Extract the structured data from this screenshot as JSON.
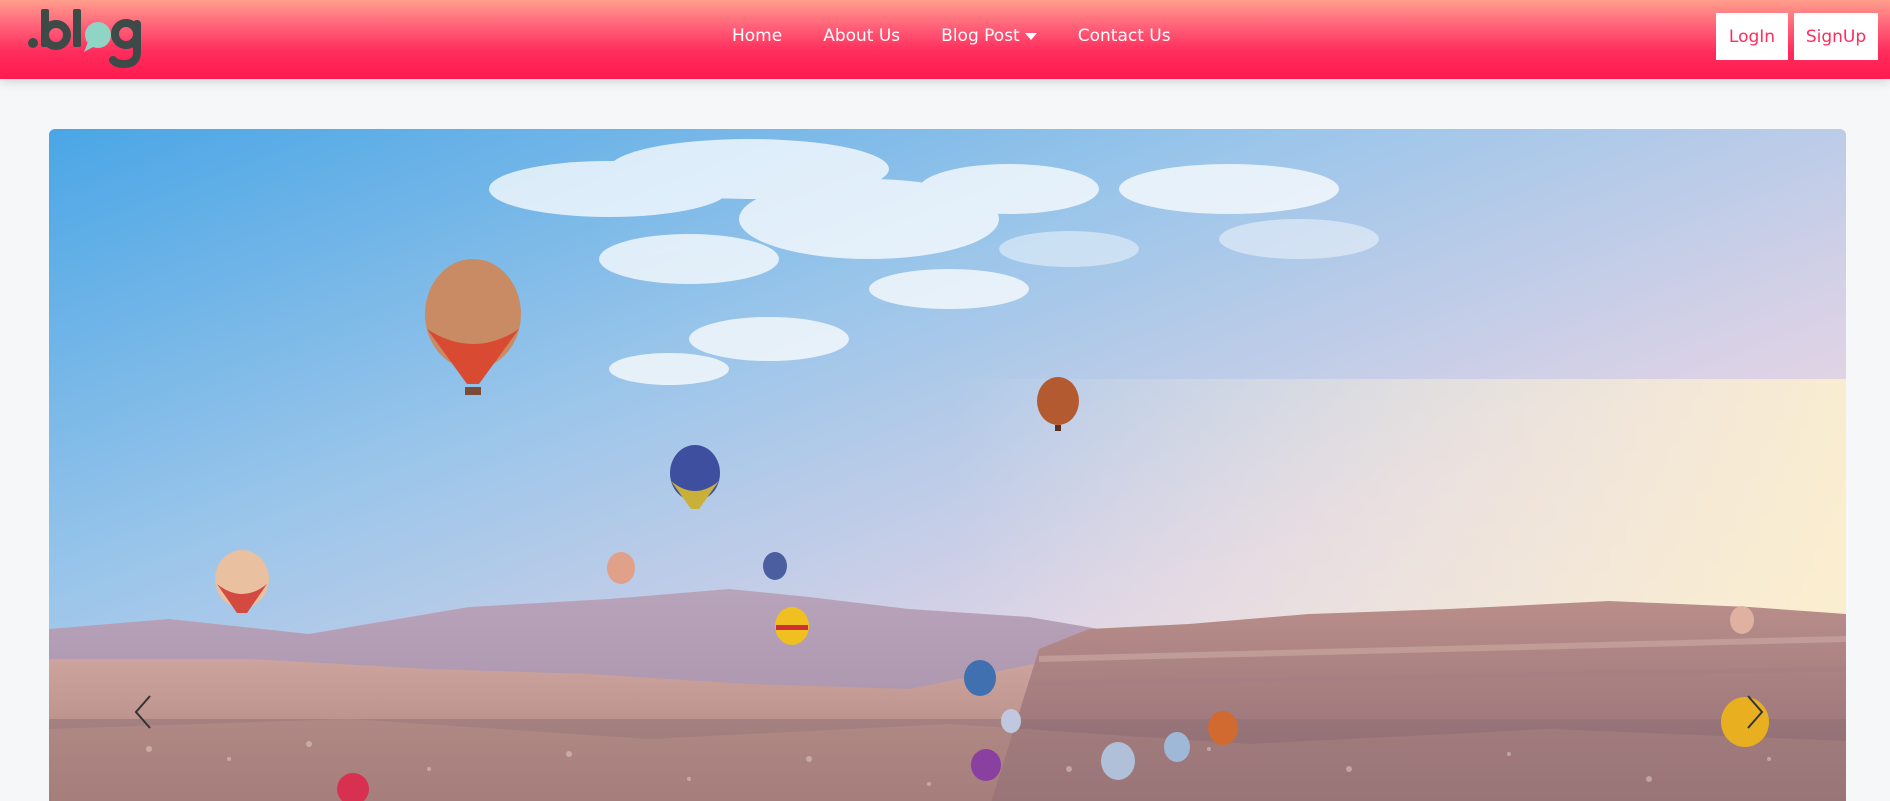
{
  "brand": {
    "name": ".blog"
  },
  "nav": {
    "items": [
      {
        "label": "Home"
      },
      {
        "label": "About Us"
      },
      {
        "label": "Blog Post",
        "has_dropdown": true
      },
      {
        "label": "Contact Us"
      }
    ]
  },
  "auth": {
    "login_label": "LogIn",
    "signup_label": "SignUp"
  },
  "hero": {
    "image": "hot-air-balloons-over-valley",
    "prev_icon": "chevron-left-icon",
    "next_icon": "chevron-right-icon"
  },
  "colors": {
    "header_top": "#ff9e8c",
    "header_bottom": "#ff1a50",
    "brand_accent": "#ff2d5c",
    "logo_dark": "#3d4a47",
    "logo_bubble": "#8fd4c4"
  }
}
